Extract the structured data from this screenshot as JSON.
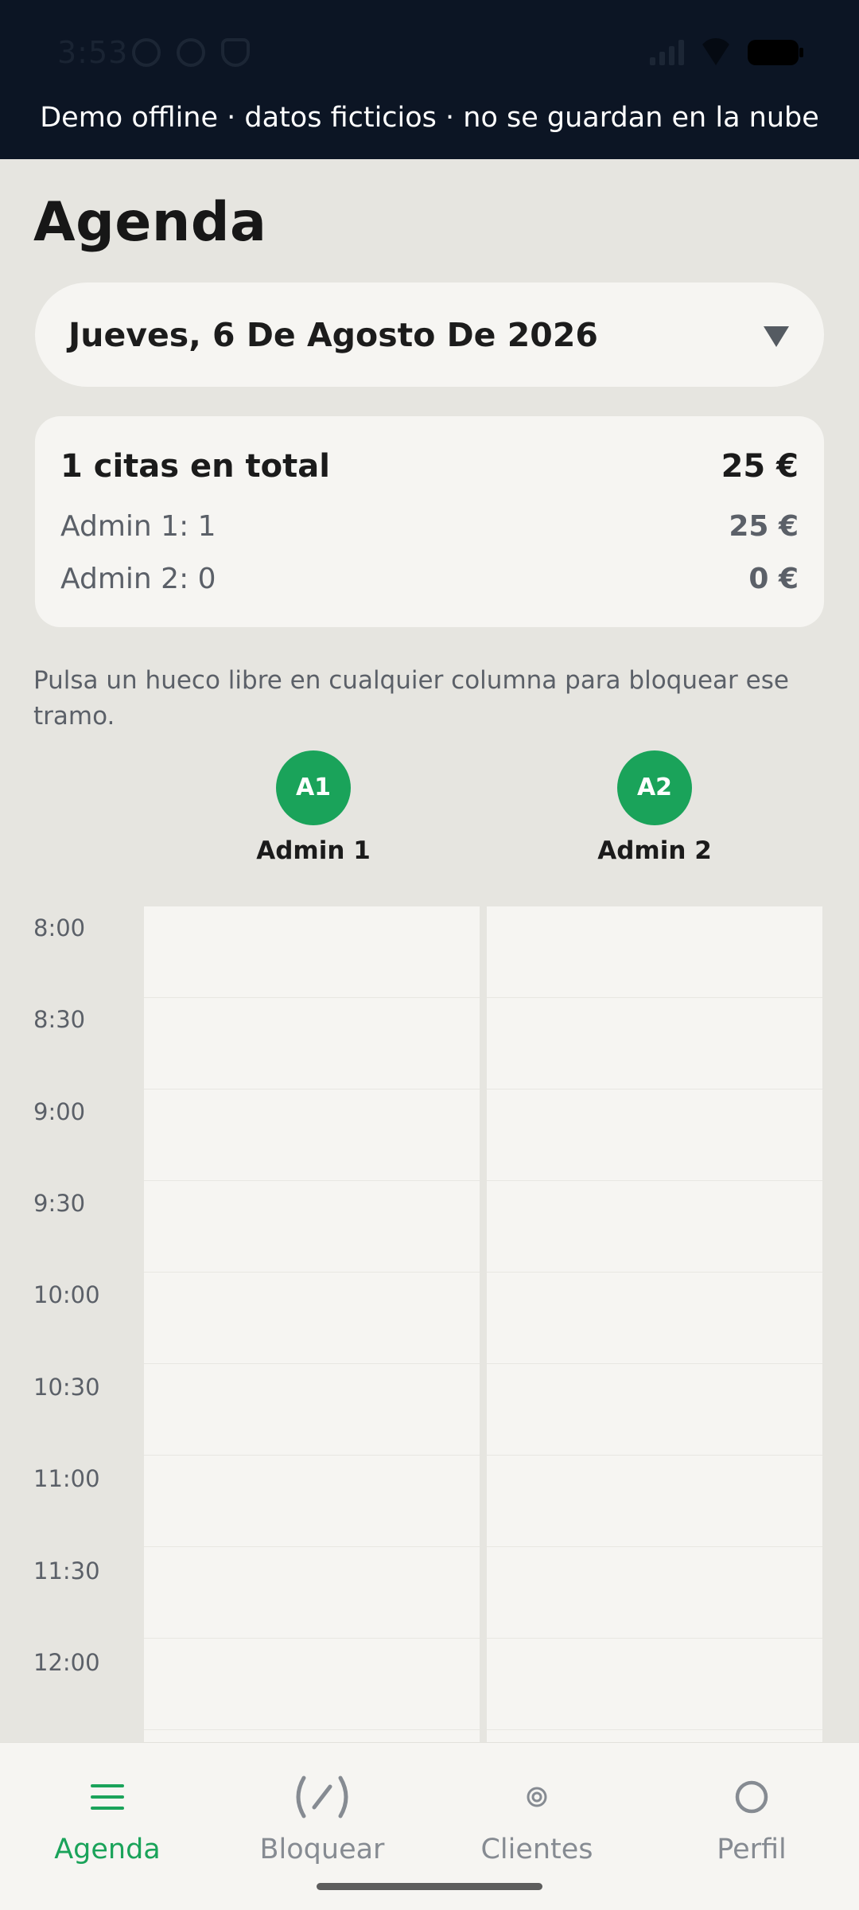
{
  "status_bar": {
    "time": "3:53"
  },
  "banner": {
    "text": "Demo offline · datos ficticios · no se guardan en la nube"
  },
  "page": {
    "title": "Agenda"
  },
  "date_selector": {
    "label": "Jueves, 6 De Agosto De 2026"
  },
  "summary": {
    "total_label": "1 citas en total",
    "total_amount": "25 €",
    "rows": [
      {
        "label": "Admin 1: 1",
        "amount": "25 €"
      },
      {
        "label": "Admin 2: 0",
        "amount": "0 €"
      }
    ]
  },
  "hint": "Pulsa un hueco libre en cualquier columna para bloquear ese tramo.",
  "columns": [
    {
      "initials": "A1",
      "name": "Admin 1"
    },
    {
      "initials": "A2",
      "name": "Admin 2"
    }
  ],
  "time_slots": [
    "8:00",
    "8:30",
    "9:00",
    "9:30",
    "10:00",
    "10:30",
    "11:00",
    "11:30",
    "12:00"
  ],
  "nav": [
    {
      "label": "Agenda",
      "icon": "menu-icon",
      "active": true
    },
    {
      "label": "Bloquear",
      "icon": "block-icon",
      "active": false
    },
    {
      "label": "Clientes",
      "icon": "clients-icon",
      "active": false
    },
    {
      "label": "Perfil",
      "icon": "profile-icon",
      "active": false
    }
  ],
  "colors": {
    "accent": "#1aa35a",
    "banner_bg": "#0c1524",
    "page_bg": "#e6e5e0",
    "card_bg": "#f6f5f2"
  }
}
